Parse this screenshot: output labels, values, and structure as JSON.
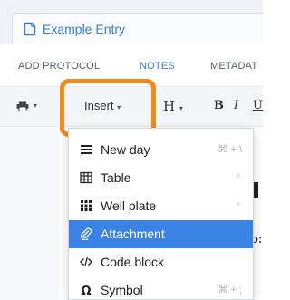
{
  "entry": {
    "title": "Example Entry"
  },
  "tabs": [
    {
      "label": "ADD PROTOCOL"
    },
    {
      "label": "NOTES"
    },
    {
      "label": "METADAT"
    }
  ],
  "toolbar": {
    "print_icon": "printer-icon",
    "insert_label": "Insert",
    "heading_label": "H",
    "bold_label": "B",
    "italic_label": "I",
    "underline_label": "U",
    "caret": "▾"
  },
  "insert_menu": {
    "items": [
      {
        "label": "New day",
        "icon": "new-day-icon",
        "shortcut": "⌘ + \\"
      },
      {
        "label": "Table",
        "icon": "table-icon",
        "submenu_arrow": "›"
      },
      {
        "label": "Well plate",
        "icon": "well-plate-icon",
        "submenu_arrow": "›"
      },
      {
        "label": "Attachment",
        "icon": "paperclip-icon"
      },
      {
        "label": "Code block",
        "icon": "code-icon"
      },
      {
        "label": "Symbol",
        "icon": "omega-icon",
        "shortcut": "⌘ + ;"
      }
    ]
  },
  "content": {
    "partial_text": "o:"
  },
  "colors": {
    "accent": "#3a7bd5",
    "menu_active": "#3b82e6",
    "highlight": "#f28a1b"
  }
}
